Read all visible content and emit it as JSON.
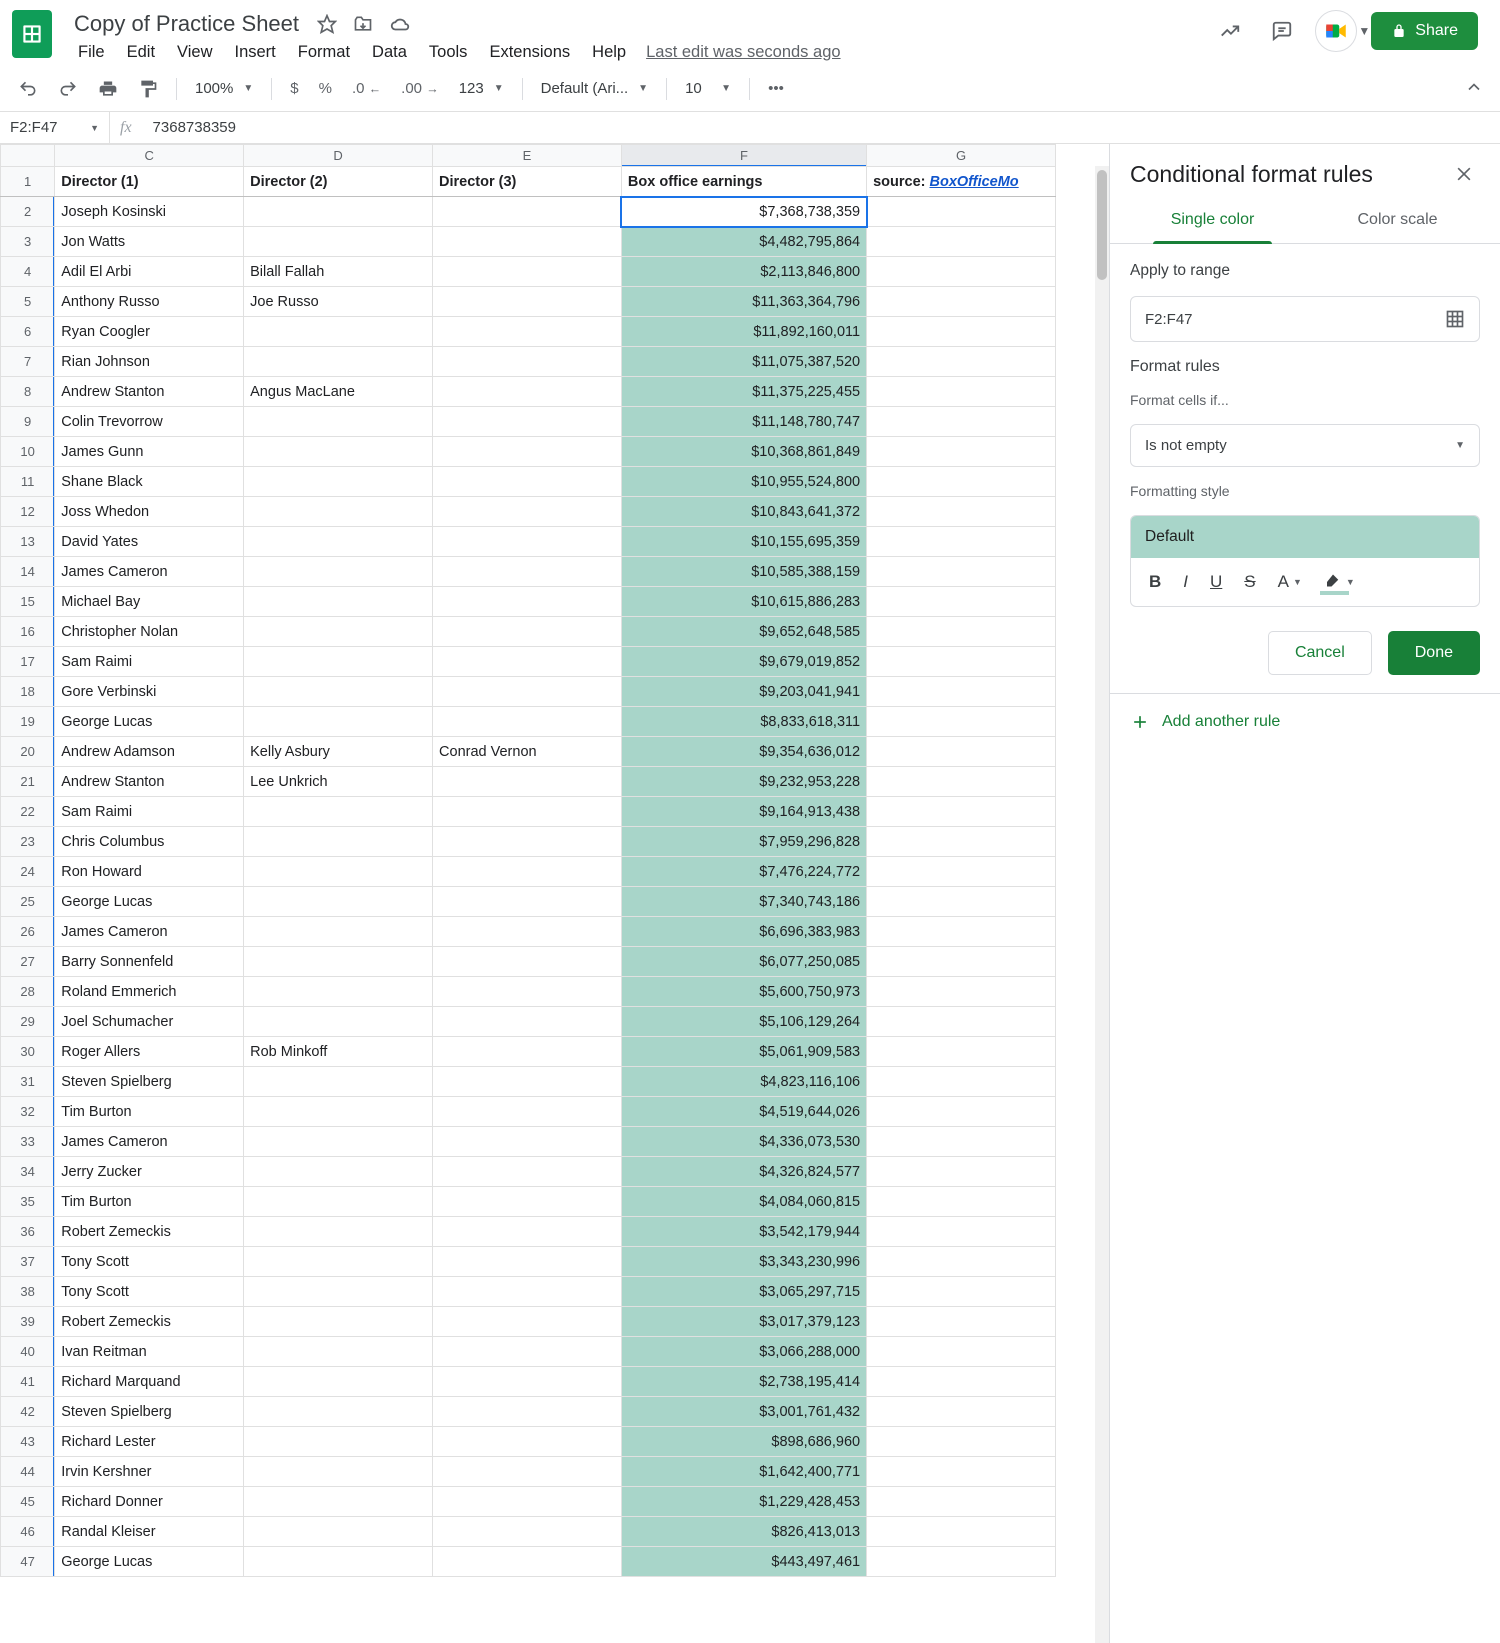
{
  "doc": {
    "title": "Copy of Practice Sheet",
    "last_edit": "Last edit was seconds ago"
  },
  "menu": {
    "file": "File",
    "edit": "Edit",
    "view": "View",
    "insert": "Insert",
    "format": "Format",
    "data": "Data",
    "tools": "Tools",
    "extensions": "Extensions",
    "help": "Help"
  },
  "header": {
    "share": "Share"
  },
  "toolbar": {
    "zoom": "100%",
    "font": "Default (Ari...",
    "size": "10",
    "currency": "$",
    "pct": "%",
    "dec_dec": ".0",
    "inc_dec": ".00",
    "num": "123"
  },
  "formula": {
    "namebox": "F2:F47",
    "value": "7368738359"
  },
  "colheads": {
    "C": "C",
    "D": "D",
    "E": "E",
    "F": "F",
    "G": "G"
  },
  "headers": {
    "C": "Director (1)",
    "D": "Director (2)",
    "E": "Director (3)",
    "F": "Box office earnings",
    "G_prefix": "source: ",
    "G_link": "BoxOfficeMo"
  },
  "sidebar": {
    "title": "Conditional format rules",
    "tab_single": "Single color",
    "tab_scale": "Color scale",
    "apply_label": "Apply to range",
    "range": "F2:F47",
    "rules_title": "Format rules",
    "format_if": "Format cells if...",
    "condition": "Is not empty",
    "style_label": "Formatting style",
    "style_preview": "Default",
    "cancel": "Cancel",
    "done": "Done",
    "add": "Add another rule"
  },
  "rows": [
    {
      "n": 2,
      "c": "Joseph Kosinski",
      "d": "",
      "e": "",
      "f": "$7,368,738,359"
    },
    {
      "n": 3,
      "c": "Jon Watts",
      "d": "",
      "e": "",
      "f": "$4,482,795,864"
    },
    {
      "n": 4,
      "c": "Adil El Arbi",
      "d": "Bilall Fallah",
      "e": "",
      "f": "$2,113,846,800"
    },
    {
      "n": 5,
      "c": "Anthony Russo",
      "d": "Joe Russo",
      "e": "",
      "f": "$11,363,364,796"
    },
    {
      "n": 6,
      "c": "Ryan Coogler",
      "d": "",
      "e": "",
      "f": "$11,892,160,011"
    },
    {
      "n": 7,
      "c": "Rian Johnson",
      "d": "",
      "e": "",
      "f": "$11,075,387,520"
    },
    {
      "n": 8,
      "c": "Andrew Stanton",
      "d": "Angus MacLane",
      "e": "",
      "f": "$11,375,225,455"
    },
    {
      "n": 9,
      "c": "Colin Trevorrow",
      "d": "",
      "e": "",
      "f": "$11,148,780,747"
    },
    {
      "n": 10,
      "c": "James Gunn",
      "d": "",
      "e": "",
      "f": "$10,368,861,849"
    },
    {
      "n": 11,
      "c": "Shane Black",
      "d": "",
      "e": "",
      "f": "$10,955,524,800"
    },
    {
      "n": 12,
      "c": "Joss Whedon",
      "d": "",
      "e": "",
      "f": "$10,843,641,372"
    },
    {
      "n": 13,
      "c": "David Yates",
      "d": "",
      "e": "",
      "f": "$10,155,695,359"
    },
    {
      "n": 14,
      "c": "James Cameron",
      "d": "",
      "e": "",
      "f": "$10,585,388,159"
    },
    {
      "n": 15,
      "c": "Michael Bay",
      "d": "",
      "e": "",
      "f": "$10,615,886,283"
    },
    {
      "n": 16,
      "c": "Christopher Nolan",
      "d": "",
      "e": "",
      "f": "$9,652,648,585"
    },
    {
      "n": 17,
      "c": "Sam Raimi",
      "d": "",
      "e": "",
      "f": "$9,679,019,852"
    },
    {
      "n": 18,
      "c": "Gore Verbinski",
      "d": "",
      "e": "",
      "f": "$9,203,041,941"
    },
    {
      "n": 19,
      "c": "George Lucas",
      "d": "",
      "e": "",
      "f": "$8,833,618,311"
    },
    {
      "n": 20,
      "c": "Andrew Adamson",
      "d": "Kelly Asbury",
      "e": "Conrad Vernon",
      "f": "$9,354,636,012"
    },
    {
      "n": 21,
      "c": "Andrew Stanton",
      "d": "Lee Unkrich",
      "e": "",
      "f": "$9,232,953,228"
    },
    {
      "n": 22,
      "c": "Sam Raimi",
      "d": "",
      "e": "",
      "f": "$9,164,913,438"
    },
    {
      "n": 23,
      "c": "Chris Columbus",
      "d": "",
      "e": "",
      "f": "$7,959,296,828"
    },
    {
      "n": 24,
      "c": "Ron Howard",
      "d": "",
      "e": "",
      "f": "$7,476,224,772"
    },
    {
      "n": 25,
      "c": "George Lucas",
      "d": "",
      "e": "",
      "f": "$7,340,743,186"
    },
    {
      "n": 26,
      "c": "James Cameron",
      "d": "",
      "e": "",
      "f": "$6,696,383,983"
    },
    {
      "n": 27,
      "c": "Barry Sonnenfeld",
      "d": "",
      "e": "",
      "f": "$6,077,250,085"
    },
    {
      "n": 28,
      "c": "Roland Emmerich",
      "d": "",
      "e": "",
      "f": "$5,600,750,973"
    },
    {
      "n": 29,
      "c": "Joel Schumacher",
      "d": "",
      "e": "",
      "f": "$5,106,129,264"
    },
    {
      "n": 30,
      "c": "Roger Allers",
      "d": "Rob Minkoff",
      "e": "",
      "f": "$5,061,909,583"
    },
    {
      "n": 31,
      "c": "Steven Spielberg",
      "d": "",
      "e": "",
      "f": "$4,823,116,106"
    },
    {
      "n": 32,
      "c": "Tim Burton",
      "d": "",
      "e": "",
      "f": "$4,519,644,026"
    },
    {
      "n": 33,
      "c": "James Cameron",
      "d": "",
      "e": "",
      "f": "$4,336,073,530"
    },
    {
      "n": 34,
      "c": "Jerry Zucker",
      "d": "",
      "e": "",
      "f": "$4,326,824,577"
    },
    {
      "n": 35,
      "c": "Tim Burton",
      "d": "",
      "e": "",
      "f": "$4,084,060,815"
    },
    {
      "n": 36,
      "c": "Robert Zemeckis",
      "d": "",
      "e": "",
      "f": "$3,542,179,944"
    },
    {
      "n": 37,
      "c": "Tony Scott",
      "d": "",
      "e": "",
      "f": "$3,343,230,996"
    },
    {
      "n": 38,
      "c": "Tony Scott",
      "d": "",
      "e": "",
      "f": "$3,065,297,715"
    },
    {
      "n": 39,
      "c": "Robert Zemeckis",
      "d": "",
      "e": "",
      "f": "$3,017,379,123"
    },
    {
      "n": 40,
      "c": "Ivan Reitman",
      "d": "",
      "e": "",
      "f": "$3,066,288,000"
    },
    {
      "n": 41,
      "c": "Richard Marquand",
      "d": "",
      "e": "",
      "f": "$2,738,195,414"
    },
    {
      "n": 42,
      "c": "Steven Spielberg",
      "d": "",
      "e": "",
      "f": "$3,001,761,432"
    },
    {
      "n": 43,
      "c": "Richard Lester",
      "d": "",
      "e": "",
      "f": "$898,686,960"
    },
    {
      "n": 44,
      "c": "Irvin Kershner",
      "d": "",
      "e": "",
      "f": "$1,642,400,771"
    },
    {
      "n": 45,
      "c": "Richard Donner",
      "d": "",
      "e": "",
      "f": "$1,229,428,453"
    },
    {
      "n": 46,
      "c": "Randal Kleiser",
      "d": "",
      "e": "",
      "f": "$826,413,013"
    },
    {
      "n": 47,
      "c": "George Lucas",
      "d": "",
      "e": "",
      "f": "$443,497,461"
    }
  ]
}
